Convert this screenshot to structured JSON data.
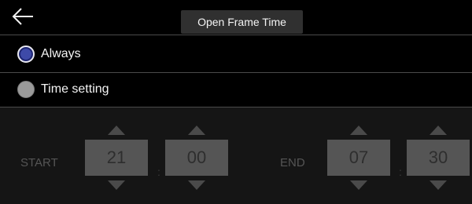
{
  "header": {
    "back_icon": "arrow-left-icon",
    "title": "Open Frame Time"
  },
  "options": [
    {
      "label": "Always",
      "selected": true
    },
    {
      "label": "Time setting",
      "selected": false
    }
  ],
  "time": {
    "start_label": "START",
    "start_hour": "21",
    "start_minute": "00",
    "end_label": "END",
    "end_hour": "07",
    "end_minute": "30",
    "separator": ":"
  },
  "colors": {
    "background": "#000000",
    "selected_radio": "#3e4aa8",
    "disabled_box": "#555555"
  }
}
